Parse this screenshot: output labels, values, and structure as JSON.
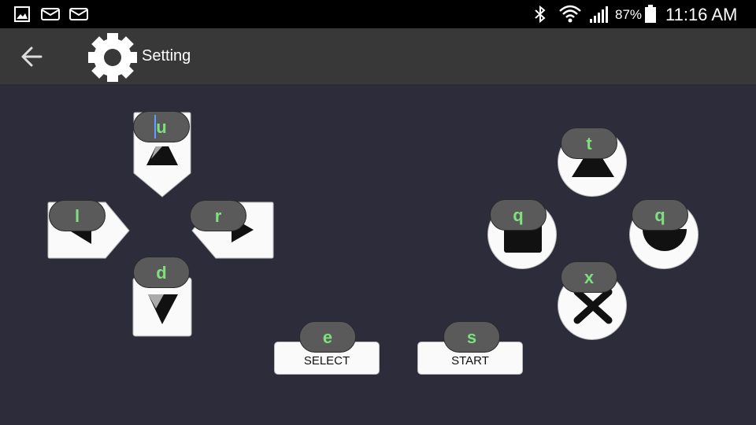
{
  "status_bar": {
    "battery_percent": "87%",
    "time": "11:16 AM",
    "icons": [
      "gallery-icon",
      "mail-icon",
      "mail-icon",
      "bluetooth-icon",
      "wifi-icon",
      "signal-icon",
      "battery-icon"
    ]
  },
  "app_bar": {
    "title": "Setting",
    "back_icon": "arrow-left-icon",
    "settings_icon": "gear-icon"
  },
  "dpad": {
    "up_key": "u",
    "left_key": "l",
    "right_key": "r",
    "down_key": "d"
  },
  "center_buttons": {
    "select_key": "e",
    "select_label": "SELECT",
    "start_key": "s",
    "start_label": "START"
  },
  "face_buttons": {
    "triangle_key": "t",
    "square_key": "q",
    "circle_key": "q",
    "cross_key": "x"
  },
  "colors": {
    "background": "#2c2c3a",
    "app_bar": "#383838",
    "key_label": "#7ee07e",
    "key_tag": "#5a5a5a"
  }
}
